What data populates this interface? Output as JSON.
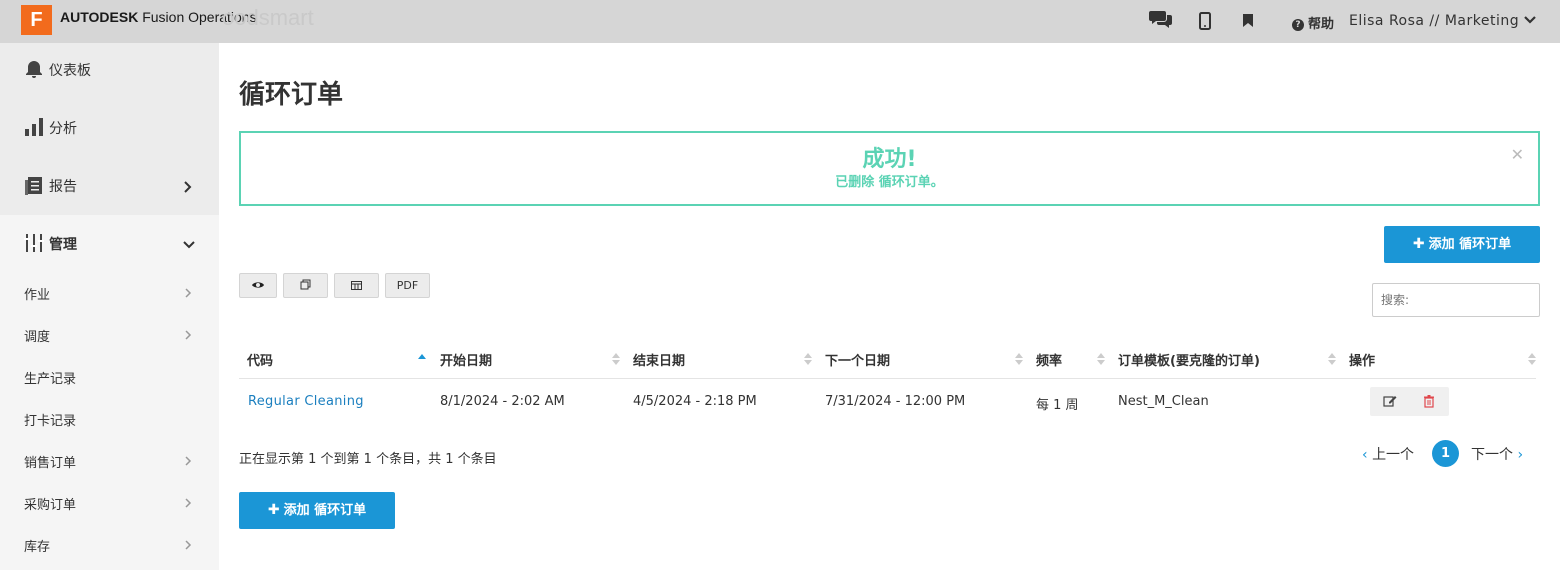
{
  "header": {
    "logo_letter": "F",
    "brand_bold": "AUTODESK",
    "brand_rest": "Fusion Operations",
    "brand_ghost": "oodsmart",
    "help_label": "帮助",
    "user": "Elisa Rosa // Marketing",
    "icons": [
      "chat-icon",
      "mobile-icon",
      "bookmark-icon",
      "help-icon",
      "chevron-down-icon"
    ]
  },
  "sidebar": {
    "items": [
      {
        "label": "仪表板",
        "icon": "bell-icon"
      },
      {
        "label": "分析",
        "icon": "bar-chart-icon"
      },
      {
        "label": "报告",
        "icon": "report-icon"
      },
      {
        "label": "管理",
        "icon": "sliders-icon"
      }
    ],
    "sub_items": [
      {
        "label": "作业"
      },
      {
        "label": "调度"
      },
      {
        "label": "生产记录"
      },
      {
        "label": "打卡记录"
      },
      {
        "label": "销售订单"
      },
      {
        "label": "采购订单"
      },
      {
        "label": "库存"
      }
    ]
  },
  "main": {
    "title": "循环订单",
    "alert": {
      "title": "成功!",
      "message": "已删除 循环订单。"
    },
    "add_button": "添加 循环订单",
    "tools": [
      "eye-icon",
      "copy-icon",
      "columns-icon",
      "PDF"
    ],
    "search_placeholder": "搜索:"
  },
  "table": {
    "columns": [
      "代码",
      "开始日期",
      "结束日期",
      "下一个日期",
      "频率",
      "订单模板(要克隆的订单)",
      "操作"
    ],
    "rows": [
      {
        "code": "Regular Cleaning",
        "start": "8/1/2024 - 2:02 AM",
        "end": "4/5/2024 - 2:18 PM",
        "next": "7/31/2024 - 12:00 PM",
        "freq": "每 1 周",
        "template": "Nest_M_Clean"
      }
    ]
  },
  "footer": {
    "info": "正在显示第 1 个到第 1 个条目，共 1 个条目",
    "prev": "上一个",
    "page": "1",
    "next": "下一个"
  },
  "colors": {
    "accent": "#1b96d6",
    "success": "#5bd3b4",
    "logo": "#f26b1d",
    "link": "#1b7fbf"
  }
}
